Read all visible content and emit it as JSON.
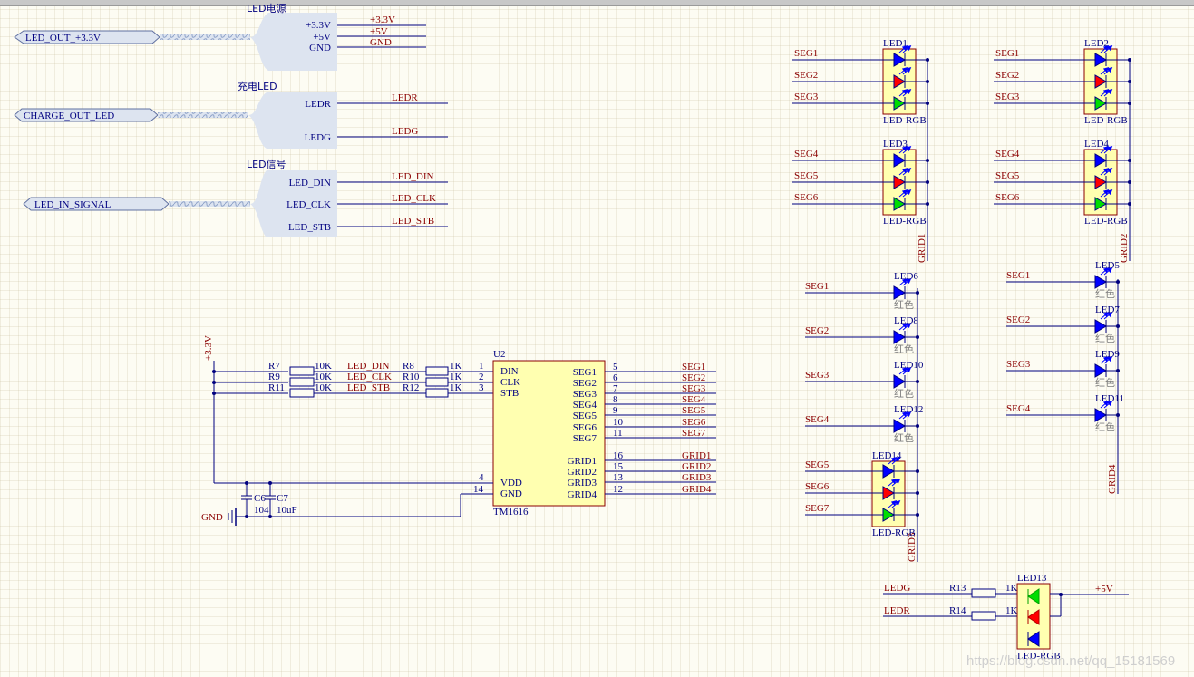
{
  "ports": {
    "led_out": "LED_OUT_+3.3V",
    "charge_out": "CHARGE_OUT_LED",
    "led_in": "LED_IN_SIGNAL"
  },
  "sheets": {
    "power": {
      "title": "LED电源",
      "pins": [
        "+3.3V",
        "+5V",
        "GND"
      ],
      "nets": [
        "+3.3V",
        "+5V",
        "GND"
      ]
    },
    "charge": {
      "title": "充电LED",
      "pins": [
        "LEDR",
        "LEDG"
      ],
      "nets": [
        "LEDR",
        "LEDG"
      ]
    },
    "signal": {
      "title": "LED信号",
      "pins": [
        "LED_DIN",
        "LED_CLK",
        "LED_STB"
      ],
      "nets": [
        "LED_DIN",
        "LED_CLK",
        "LED_STB"
      ]
    }
  },
  "driver": {
    "ref": "U2",
    "part": "TM1616",
    "left_pins": [
      {
        "name": "DIN",
        "num": "1"
      },
      {
        "name": "CLK",
        "num": "2"
      },
      {
        "name": "STB",
        "num": "3"
      },
      {
        "name": "VDD",
        "num": "4"
      },
      {
        "name": "GND",
        "num": "14"
      }
    ],
    "right_pins": [
      {
        "name": "SEG1",
        "num": "5",
        "net": "SEG1"
      },
      {
        "name": "SEG2",
        "num": "6",
        "net": "SEG2"
      },
      {
        "name": "SEG3",
        "num": "7",
        "net": "SEG3"
      },
      {
        "name": "SEG4",
        "num": "8",
        "net": "SEG4"
      },
      {
        "name": "SEG5",
        "num": "9",
        "net": "SEG5"
      },
      {
        "name": "SEG6",
        "num": "10",
        "net": "SEG6"
      },
      {
        "name": "SEG7",
        "num": "11",
        "net": "SEG7"
      },
      {
        "name": "GRID1",
        "num": "16",
        "net": "GRID1"
      },
      {
        "name": "GRID2",
        "num": "15",
        "net": "GRID2"
      },
      {
        "name": "GRID3",
        "num": "13",
        "net": "GRID3"
      },
      {
        "name": "GRID4",
        "num": "12",
        "net": "GRID4"
      }
    ],
    "resistors": [
      {
        "ref": "R7",
        "value": "10K",
        "net": "LED_DIN"
      },
      {
        "ref": "R9",
        "value": "10K",
        "net": "LED_CLK"
      },
      {
        "ref": "R11",
        "value": "10K",
        "net": "LED_STB"
      },
      {
        "ref": "R8",
        "value": "1K"
      },
      {
        "ref": "R10",
        "value": "1K"
      },
      {
        "ref": "R12",
        "value": "1K"
      }
    ],
    "supply": "+3.3V",
    "ground": "GND",
    "caps": [
      {
        "ref": "C6",
        "value": "104"
      },
      {
        "ref": "C7",
        "value": "10uF"
      }
    ]
  },
  "rgb_leds": [
    {
      "ref": "LED1",
      "part": "LED-RGB",
      "segs": [
        "SEG1",
        "SEG2",
        "SEG3"
      ]
    },
    {
      "ref": "LED2",
      "part": "LED-RGB",
      "segs": [
        "SEG1",
        "SEG2",
        "SEG3"
      ]
    },
    {
      "ref": "LED3",
      "part": "LED-RGB",
      "segs": [
        "SEG4",
        "SEG5",
        "SEG6"
      ]
    },
    {
      "ref": "LED4",
      "part": "LED-RGB",
      "segs": [
        "SEG4",
        "SEG5",
        "SEG6"
      ]
    }
  ],
  "grid_nets": [
    "GRID1",
    "GRID2",
    "GRID3",
    "GRID4"
  ],
  "single_leds_grid3": [
    {
      "ref": "LED6",
      "seg": "SEG1",
      "color": "红色"
    },
    {
      "ref": "LED8",
      "seg": "SEG2",
      "color": "红色"
    },
    {
      "ref": "LED10",
      "seg": "SEG3",
      "color": "红色"
    },
    {
      "ref": "LED12",
      "seg": "SEG4",
      "color": "红色"
    }
  ],
  "led14": {
    "ref": "LED14",
    "part": "LED-RGB",
    "segs": [
      "SEG5",
      "SEG6",
      "SEG7"
    ]
  },
  "single_leds_grid4": [
    {
      "ref": "LED5",
      "seg": "SEG1",
      "color": "红色"
    },
    {
      "ref": "LED7",
      "seg": "SEG2",
      "color": "红色"
    },
    {
      "ref": "LED9",
      "seg": "SEG3",
      "color": "红色"
    },
    {
      "ref": "LED11",
      "seg": "SEG4",
      "color": "红色"
    }
  ],
  "charge_led": {
    "ref": "LED13",
    "part": "LED-RGB",
    "inputs": [
      "LEDG",
      "LEDR"
    ],
    "resistors": [
      {
        "ref": "R13",
        "value": "1K"
      },
      {
        "ref": "R14",
        "value": "1K"
      }
    ],
    "supply": "+5V"
  },
  "watermark": "https://blog.csdn.net/qq_15181569",
  "colors": {
    "wire": "#00007f",
    "net": "#8b0000",
    "body": "#ffffb0",
    "led_blue": "#0000ff",
    "led_red": "#ff0000",
    "led_green": "#00dd00",
    "sheet": "#dde4f0"
  }
}
